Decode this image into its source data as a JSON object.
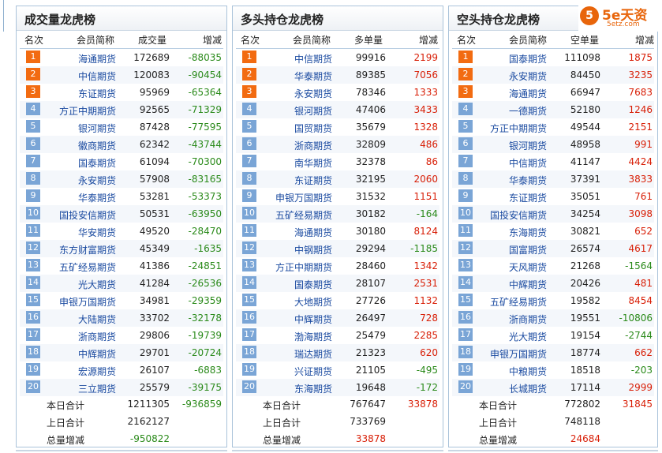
{
  "logo": {
    "mark": "5",
    "text": "5e天资",
    "sub": "5etz.com"
  },
  "headers": {
    "rank": "名次",
    "member": "会员简称"
  },
  "panels": [
    {
      "title": "成交量龙虎榜",
      "col_value": "成交量",
      "col_change": "增减",
      "rows": [
        {
          "rank": "1",
          "name": "海通期货",
          "value": "172689",
          "change": "-88035"
        },
        {
          "rank": "2",
          "name": "中信期货",
          "value": "120083",
          "change": "-90454"
        },
        {
          "rank": "3",
          "name": "东证期货",
          "value": "95969",
          "change": "-65364"
        },
        {
          "rank": "4",
          "name": "方正中期期货",
          "value": "92565",
          "change": "-71329"
        },
        {
          "rank": "5",
          "name": "银河期货",
          "value": "87428",
          "change": "-77595"
        },
        {
          "rank": "6",
          "name": "徽商期货",
          "value": "62342",
          "change": "-43744"
        },
        {
          "rank": "7",
          "name": "国泰期货",
          "value": "61094",
          "change": "-70300"
        },
        {
          "rank": "8",
          "name": "永安期货",
          "value": "57908",
          "change": "-83165"
        },
        {
          "rank": "9",
          "name": "华泰期货",
          "value": "53281",
          "change": "-53373"
        },
        {
          "rank": "10",
          "name": "国投安信期货",
          "value": "50531",
          "change": "-63950"
        },
        {
          "rank": "11",
          "name": "华安期货",
          "value": "49520",
          "change": "-28470"
        },
        {
          "rank": "12",
          "name": "东方财富期货",
          "value": "45349",
          "change": "-1635"
        },
        {
          "rank": "13",
          "name": "五矿经易期货",
          "value": "41386",
          "change": "-24851"
        },
        {
          "rank": "14",
          "name": "光大期货",
          "value": "41284",
          "change": "-26536"
        },
        {
          "rank": "15",
          "name": "申银万国期货",
          "value": "34981",
          "change": "-29359"
        },
        {
          "rank": "16",
          "name": "大陆期货",
          "value": "33702",
          "change": "-32178"
        },
        {
          "rank": "17",
          "name": "浙商期货",
          "value": "29806",
          "change": "-19739"
        },
        {
          "rank": "18",
          "name": "中辉期货",
          "value": "29701",
          "change": "-20724"
        },
        {
          "rank": "19",
          "name": "宏源期货",
          "value": "26107",
          "change": "-6883"
        },
        {
          "rank": "20",
          "name": "三立期货",
          "value": "25579",
          "change": "-39175"
        }
      ],
      "totals": [
        {
          "label": "本日合计",
          "value": "1211305",
          "change": "-936859"
        },
        {
          "label": "上日合计",
          "value": "2162127",
          "change": ""
        },
        {
          "label": "总量增减",
          "value": "-950822",
          "change": ""
        }
      ]
    },
    {
      "title": "多头持仓龙虎榜",
      "col_value": "多单量",
      "col_change": "增减",
      "rows": [
        {
          "rank": "1",
          "name": "中信期货",
          "value": "99916",
          "change": "2199"
        },
        {
          "rank": "2",
          "name": "华泰期货",
          "value": "89385",
          "change": "7056"
        },
        {
          "rank": "3",
          "name": "永安期货",
          "value": "78346",
          "change": "1333"
        },
        {
          "rank": "4",
          "name": "银河期货",
          "value": "47406",
          "change": "3433"
        },
        {
          "rank": "5",
          "name": "国贸期货",
          "value": "35679",
          "change": "1328"
        },
        {
          "rank": "6",
          "name": "浙商期货",
          "value": "32809",
          "change": "486"
        },
        {
          "rank": "7",
          "name": "南华期货",
          "value": "32378",
          "change": "86"
        },
        {
          "rank": "8",
          "name": "东证期货",
          "value": "32195",
          "change": "2060"
        },
        {
          "rank": "9",
          "name": "申银万国期货",
          "value": "31532",
          "change": "1151"
        },
        {
          "rank": "10",
          "name": "五矿经易期货",
          "value": "30182",
          "change": "-164"
        },
        {
          "rank": "11",
          "name": "海通期货",
          "value": "30180",
          "change": "8124"
        },
        {
          "rank": "12",
          "name": "中钢期货",
          "value": "29294",
          "change": "-1185"
        },
        {
          "rank": "13",
          "name": "方正中期期货",
          "value": "28460",
          "change": "1342"
        },
        {
          "rank": "14",
          "name": "国泰期货",
          "value": "28107",
          "change": "2531"
        },
        {
          "rank": "15",
          "name": "大地期货",
          "value": "27726",
          "change": "1132"
        },
        {
          "rank": "16",
          "name": "中辉期货",
          "value": "26497",
          "change": "728"
        },
        {
          "rank": "17",
          "name": "渤海期货",
          "value": "25479",
          "change": "2285"
        },
        {
          "rank": "18",
          "name": "瑞达期货",
          "value": "21323",
          "change": "620"
        },
        {
          "rank": "19",
          "name": "兴证期货",
          "value": "21105",
          "change": "-495"
        },
        {
          "rank": "20",
          "name": "东海期货",
          "value": "19648",
          "change": "-172"
        }
      ],
      "totals": [
        {
          "label": "本日合计",
          "value": "767647",
          "change": "33878"
        },
        {
          "label": "上日合计",
          "value": "733769",
          "change": ""
        },
        {
          "label": "总量增减",
          "value": "33878",
          "change": ""
        }
      ]
    },
    {
      "title": "空头持仓龙虎榜",
      "col_value": "空单量",
      "col_change": "增减",
      "rows": [
        {
          "rank": "1",
          "name": "国泰期货",
          "value": "111098",
          "change": "1875"
        },
        {
          "rank": "2",
          "name": "永安期货",
          "value": "84450",
          "change": "3235"
        },
        {
          "rank": "3",
          "name": "海通期货",
          "value": "66947",
          "change": "7683"
        },
        {
          "rank": "4",
          "name": "一德期货",
          "value": "52180",
          "change": "1246"
        },
        {
          "rank": "5",
          "name": "方正中期期货",
          "value": "49544",
          "change": "2151"
        },
        {
          "rank": "6",
          "name": "银河期货",
          "value": "48958",
          "change": "991"
        },
        {
          "rank": "7",
          "name": "中信期货",
          "value": "41147",
          "change": "4424"
        },
        {
          "rank": "8",
          "name": "华泰期货",
          "value": "37391",
          "change": "3833"
        },
        {
          "rank": "9",
          "name": "东证期货",
          "value": "35051",
          "change": "761"
        },
        {
          "rank": "10",
          "name": "国投安信期货",
          "value": "34254",
          "change": "3098"
        },
        {
          "rank": "11",
          "name": "东海期货",
          "value": "30821",
          "change": "652"
        },
        {
          "rank": "12",
          "name": "国富期货",
          "value": "26574",
          "change": "4617"
        },
        {
          "rank": "13",
          "name": "天风期货",
          "value": "21268",
          "change": "-1564"
        },
        {
          "rank": "14",
          "name": "中辉期货",
          "value": "20426",
          "change": "481"
        },
        {
          "rank": "15",
          "name": "五矿经易期货",
          "value": "19582",
          "change": "8454"
        },
        {
          "rank": "16",
          "name": "浙商期货",
          "value": "19551",
          "change": "-10806"
        },
        {
          "rank": "17",
          "name": "光大期货",
          "value": "19154",
          "change": "-2744"
        },
        {
          "rank": "18",
          "name": "申银万国期货",
          "value": "18774",
          "change": "662"
        },
        {
          "rank": "19",
          "name": "中粮期货",
          "value": "18518",
          "change": "-203"
        },
        {
          "rank": "20",
          "name": "长城期货",
          "value": "17114",
          "change": "2999"
        }
      ],
      "totals": [
        {
          "label": "本日合计",
          "value": "772802",
          "change": "31845"
        },
        {
          "label": "上日合计",
          "value": "748118",
          "change": ""
        },
        {
          "label": "总量增减",
          "value": "24684",
          "change": ""
        }
      ]
    }
  ]
}
